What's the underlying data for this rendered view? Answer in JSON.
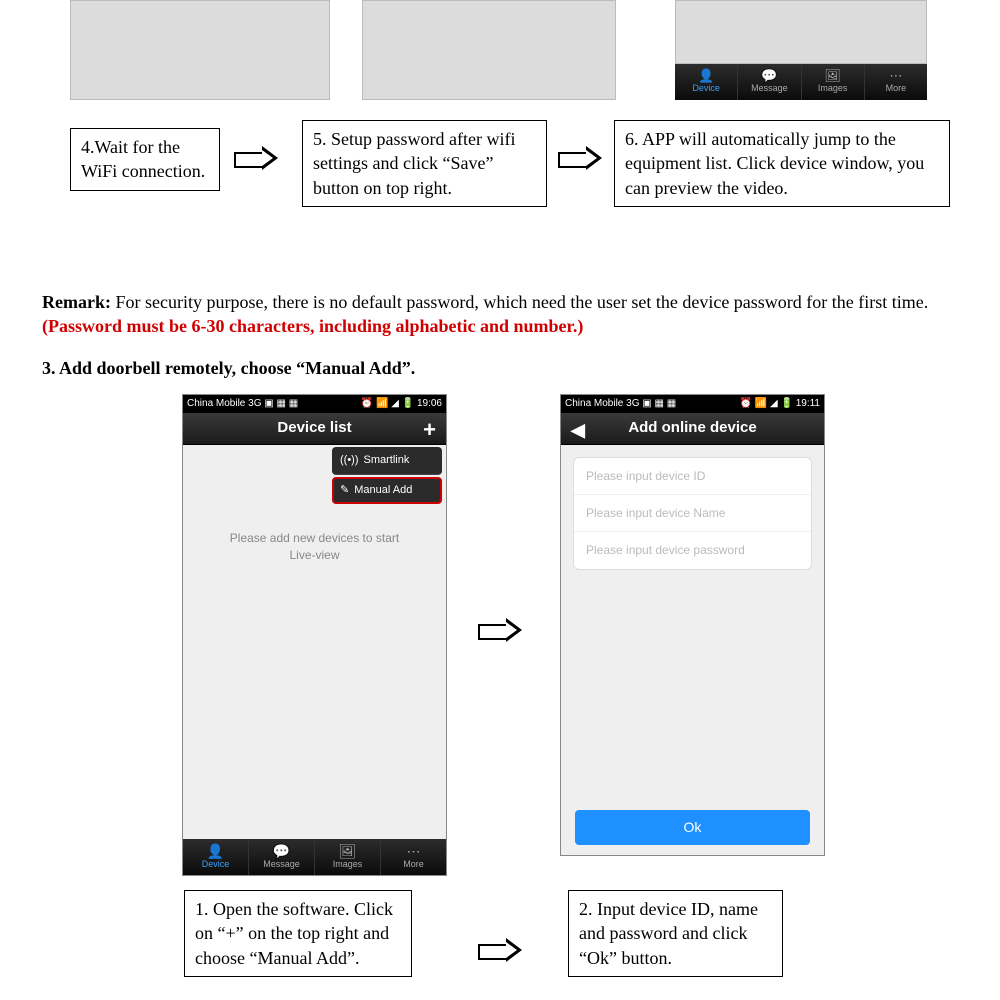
{
  "top_placeholders": {},
  "mini_nav": {
    "items": [
      "Device",
      "Message",
      "Images",
      "More"
    ]
  },
  "steps_456": {
    "s4": "4.Wait for the WiFi connection.",
    "s5": "5. Setup password after wifi settings and click “Save” button on top right.",
    "s6": "6. APP will automatically jump to the equipment list. Click device window, you can preview the video."
  },
  "remark": {
    "label": "Remark:",
    "text": " For security purpose, there is no default password, which need the user set the device password for the first time. ",
    "red": "(Password must be 6-30 characters, including alphabetic and number.)"
  },
  "section3_title": "3.  Add doorbell remotely, choose “Manual Add”.",
  "phone1": {
    "status_left": "China Mobile 3G",
    "status_right": "19:06",
    "title": "Device list",
    "dropdown": {
      "smartlink": "Smartlink",
      "manual": "Manual Add"
    },
    "center1": "Please add new devices to start",
    "center2": "Live-view",
    "nav": [
      "Device",
      "Message",
      "Images",
      "More"
    ]
  },
  "phone2": {
    "status_left": "China Mobile 3G",
    "status_right": "19:11",
    "title": "Add online device",
    "inputs": {
      "id": "Please input device ID",
      "name": "Please input device Name",
      "pwd": "Please input device password"
    },
    "ok": "Ok"
  },
  "steps_12": {
    "s1": "1. Open the software. Click on “+” on the top right and choose “Manual Add”.",
    "s2": "2. Input device ID, name and password and click “Ok” button."
  }
}
